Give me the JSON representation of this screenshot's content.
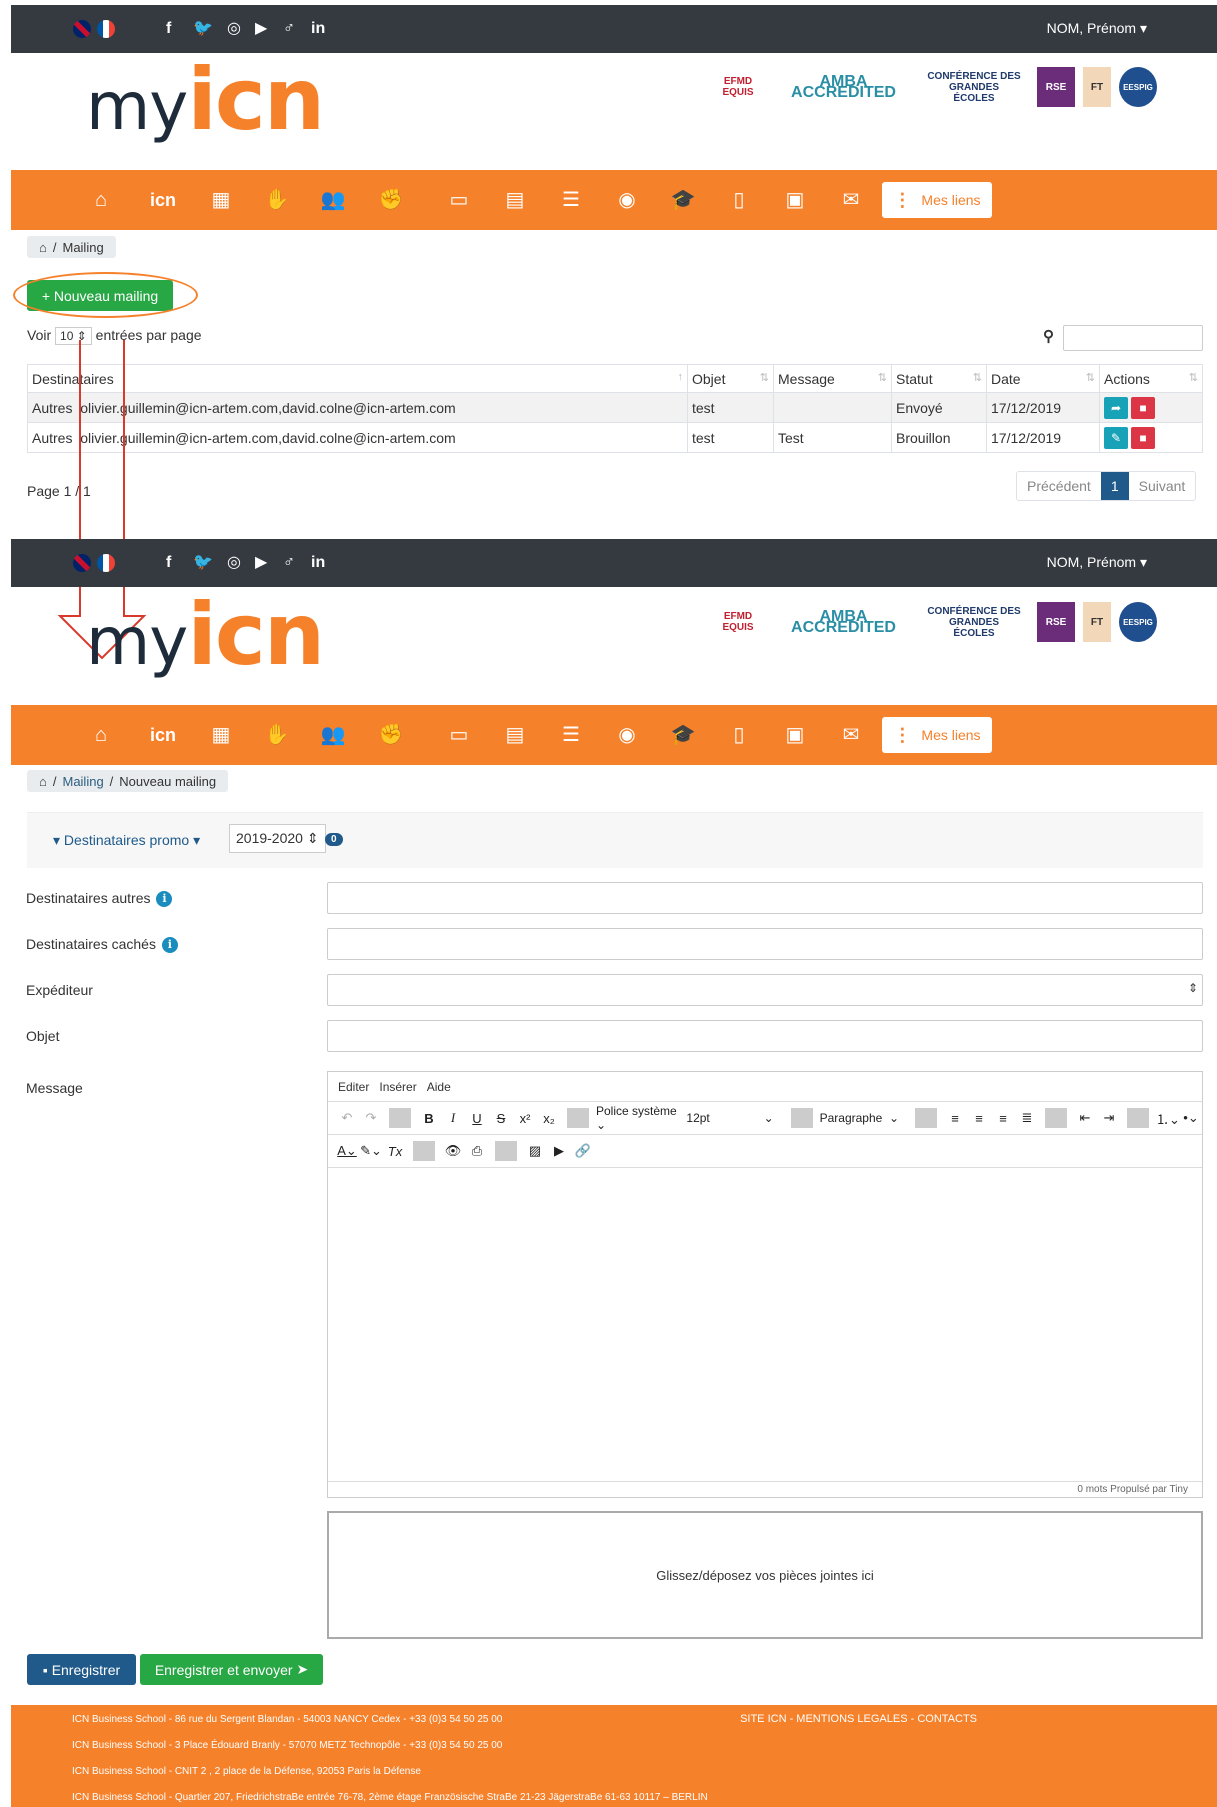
{
  "top": {
    "user": "NOM, Prénom"
  },
  "logo": {
    "my": "my",
    "icn": "icn"
  },
  "badges": [
    {
      "name": "equis-badge",
      "text": "EFMD\nEQUIS",
      "color": "#c0202f"
    },
    {
      "name": "amba-badge",
      "text": "AMBA\nACCREDITED",
      "color": "#2a8ea5"
    },
    {
      "name": "cge-badge",
      "text": "CONFÉRENCE DES\nGRANDES\nÉCOLES",
      "color": "#1f3a6b"
    },
    {
      "name": "rse-badge",
      "text": "RSE",
      "color": "#6b2d7a"
    },
    {
      "name": "ft-badge",
      "text": "FT",
      "color": "#d79b5a"
    },
    {
      "name": "eespig-badge",
      "text": "EESPIG",
      "color": "#1f4f8f"
    }
  ],
  "nav": {
    "icn_text": "icn",
    "mes_liens": "Mes liens"
  },
  "list": {
    "breadcrumb_home": "Mailing",
    "new_button": "+ Nouveau mailing",
    "show_prefix": "Voir",
    "show_value": "10",
    "show_suffix": "entrées par page",
    "columns": [
      "Destinataires",
      "Objet",
      "Message",
      "Statut",
      "Date",
      "Actions"
    ],
    "rows": [
      {
        "dest_type": "Autres",
        "dest": "olivier.guillemin@icn-artem.com,david.colne@icn-artem.com",
        "objet": "test",
        "message": "",
        "statut": "Envoyé",
        "date": "17/12/2019"
      },
      {
        "dest_type": "Autres",
        "dest": "olivier.guillemin@icn-artem.com,david.colne@icn-artem.com",
        "objet": "test",
        "message": "Test",
        "statut": "Brouillon",
        "date": "17/12/2019"
      }
    ],
    "page_info": "Page 1 / 1",
    "prev": "Précédent",
    "page_num": "1",
    "next": "Suivant"
  },
  "form": {
    "breadcrumb_1": "Mailing",
    "breadcrumb_2": "Nouveau mailing",
    "promo_toggle": "Destinataires promo",
    "year_select": "2019-2020",
    "promo_count": "0",
    "label_autres": "Destinataires autres",
    "label_caches": "Destinataires cachés",
    "label_expediteur": "Expéditeur",
    "label_objet": "Objet",
    "label_message": "Message",
    "editor_menu": [
      "Editer",
      "Insérer",
      "Aide"
    ],
    "font_family": "Police système",
    "font_size": "12pt",
    "block_format": "Paragraphe",
    "editor_status": "0 mots  Propulsé par Tiny",
    "dropzone": "Glissez/déposez vos pièces jointes ici",
    "save": "Enregistrer",
    "save_send": "Enregistrer et envoyer"
  },
  "footer": {
    "lines": [
      "ICN Business School - 86 rue du Sergent Blandan - 54003 NANCY Cedex - +33 (0)3 54 50 25 00",
      "ICN Business School - 3 Place Édouard Branly - 57070 METZ Technopôle - +33 (0)3 54 50 25 00",
      "ICN Business School - CNIT 2 , 2 place de la Défense, 92053 Paris la Défense",
      "ICN Business School - Quartier 207, FriedrichstraBe entrée 76-78, 2ème étage Französische StraBe 21-23 JägerstraBe 61-63 10117 – BERLIN"
    ],
    "links": "SITE ICN  -  MENTIONS LEGALES  -  CONTACTS"
  },
  "colors": {
    "orange": "#f6812b",
    "dark": "#343a40",
    "green": "#28a745",
    "blue": "#1f5a8a"
  }
}
